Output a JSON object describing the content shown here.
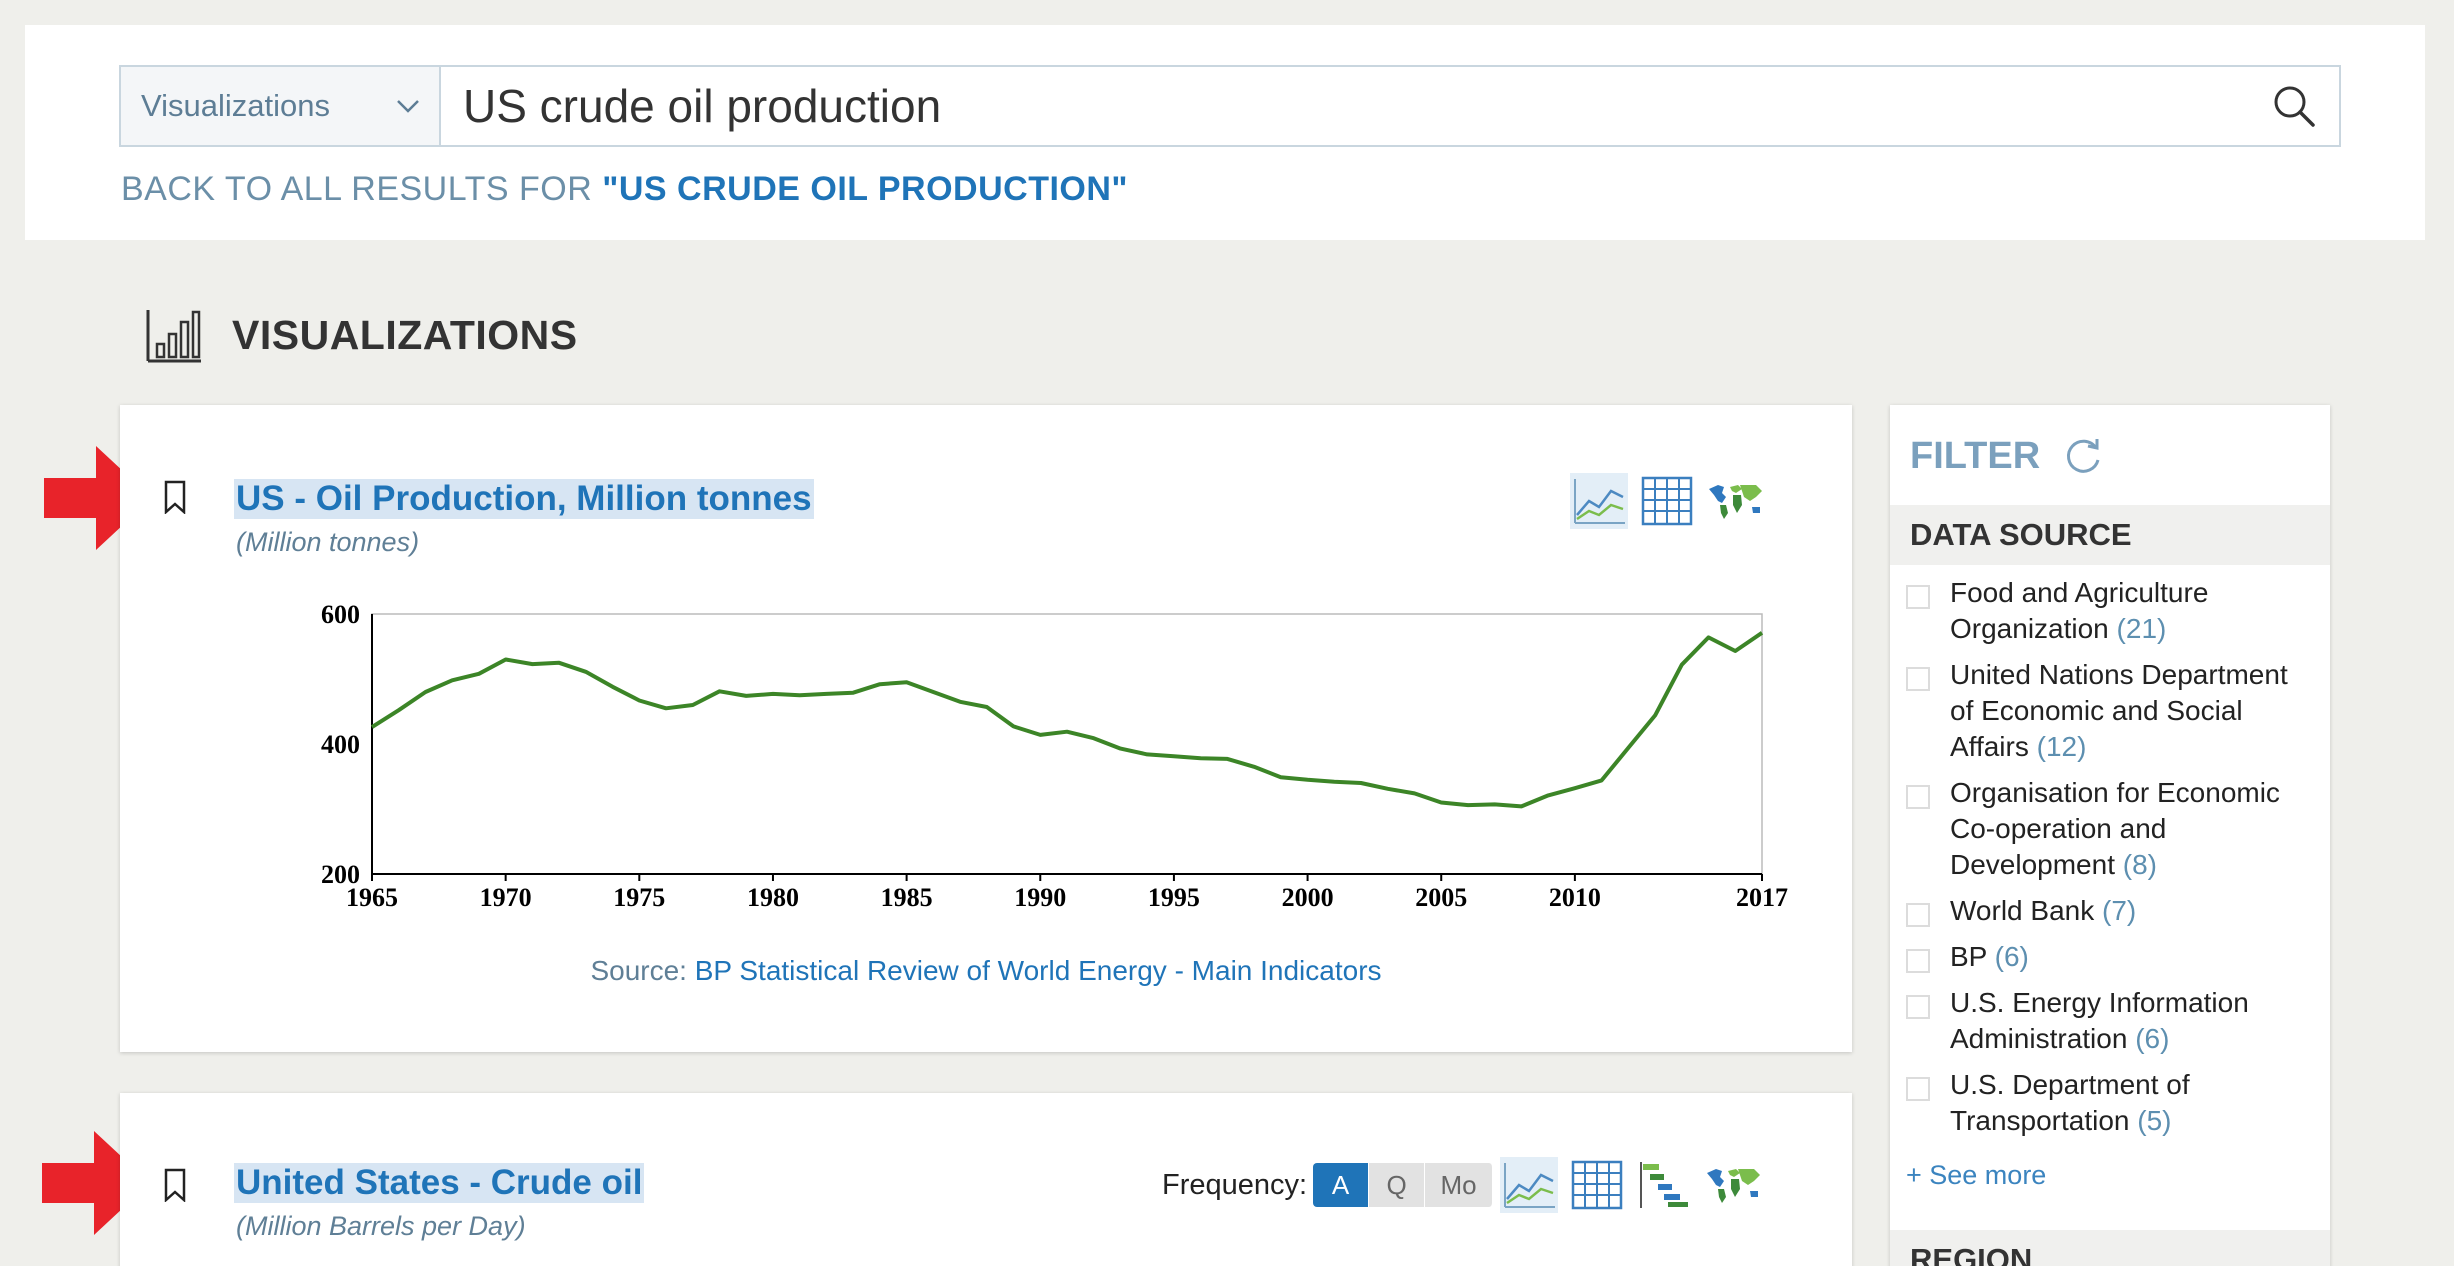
{
  "search": {
    "scope": "Visualizations",
    "query": "US crude oil production",
    "back_prefix": "BACK TO ALL RESULTS FOR ",
    "back_query": "\"US CRUDE OIL PRODUCTION\""
  },
  "section": {
    "title": "VISUALIZATIONS",
    "icon": "bar-chart-icon"
  },
  "cards": [
    {
      "title_a": "US",
      "title_sep": " - ",
      "title_b": "Oil Production, Million tonnes",
      "subtitle": "(Million tonnes)",
      "source_prefix": "Source: ",
      "source_link": "BP Statistical Review of World Energy - Main Indicators"
    },
    {
      "title_a": "United States",
      "title_sep": " - ",
      "title_b": "Crude oil",
      "subtitle": "(Million Barrels per Day)",
      "frequency_label": "Frequency:",
      "frequency_options": [
        "A",
        "Q",
        "Mo"
      ],
      "frequency_selected": "A"
    }
  ],
  "chart_data": {
    "type": "line",
    "title": "",
    "xlabel": "",
    "ylabel": "",
    "x": [
      1965,
      1966,
      1967,
      1968,
      1969,
      1970,
      1971,
      1972,
      1973,
      1974,
      1975,
      1976,
      1977,
      1978,
      1979,
      1980,
      1981,
      1982,
      1983,
      1984,
      1985,
      1986,
      1987,
      1988,
      1989,
      1990,
      1991,
      1992,
      1993,
      1994,
      1995,
      1996,
      1997,
      1998,
      1999,
      2000,
      2001,
      2002,
      2003,
      2004,
      2005,
      2006,
      2007,
      2008,
      2009,
      2010,
      2011,
      2012,
      2013,
      2014,
      2015,
      2016,
      2017
    ],
    "series": [
      {
        "values": [
          426,
          452,
          480,
          498,
          508,
          530,
          523,
          525,
          511,
          488,
          467,
          455,
          460,
          481,
          474,
          477,
          475,
          477,
          479,
          492,
          495,
          480,
          465,
          457,
          427,
          414,
          419,
          409,
          393,
          384,
          381,
          378,
          377,
          365,
          349,
          345,
          342,
          340,
          331,
          324,
          310,
          306,
          307,
          304,
          321,
          332,
          344,
          394,
          444,
          522,
          564,
          543,
          571
        ]
      }
    ],
    "xticks": [
      "1965",
      "1970",
      "1975",
      "1980",
      "1985",
      "1990",
      "1995",
      "2000",
      "2005",
      "2010",
      "2017"
    ],
    "yticks": [
      "200",
      "400",
      "600"
    ],
    "xlim": [
      1965,
      2017
    ],
    "ylim": [
      200,
      600
    ],
    "colors": {
      "line": "#3c8527"
    },
    "grid": false
  },
  "filter": {
    "title": "FILTER",
    "refresh_icon": "refresh-icon",
    "data_source_label": "DATA SOURCE",
    "items": [
      {
        "label": "Food and Agriculture Organization",
        "count": "(21)"
      },
      {
        "label": "United Nations Department of Economic and Social Affairs",
        "count": "(12)"
      },
      {
        "label": "Organisation for Economic Co-operation and Development",
        "count": "(8)"
      },
      {
        "label": "World Bank",
        "count": "(7)"
      },
      {
        "label": "BP",
        "count": "(6)"
      },
      {
        "label": "U.S. Energy Information Administration",
        "count": "(6)"
      },
      {
        "label": "U.S. Department of Transportation",
        "count": "(5)"
      }
    ],
    "see_more": "+ See more",
    "region_label": "REGION"
  },
  "colors": {
    "accent": "#1f74b8",
    "arrow": "#e8232a",
    "line": "#3c8527"
  }
}
